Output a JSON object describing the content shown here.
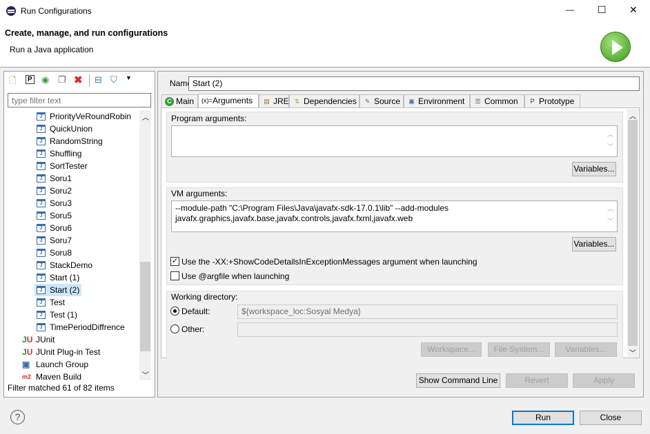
{
  "window": {
    "title": "Run Configurations",
    "minimize": "—",
    "maximize": "☐",
    "close": "✕"
  },
  "header": {
    "title": "Create, manage, and run configurations",
    "subtitle": "Run a Java application"
  },
  "left": {
    "filter_placeholder": "type filter text",
    "tree": [
      "PriorityVeRoundRobin",
      "QuickUnion",
      "RandomString",
      "Shuffling",
      "SortTester",
      "Soru1",
      "Soru2",
      "Soru3",
      "Soru5",
      "Soru6",
      "Soru7",
      "Soru8",
      "StackDemo",
      "Start (1)",
      "Start (2)",
      "Test",
      "Test (1)",
      "TimePeriodDiffrence"
    ],
    "selected": "Start (2)",
    "categories": [
      "JUnit",
      "JUnit Plug-in Test",
      "Launch Group",
      "Maven Build"
    ],
    "status": "Filter matched 61 of 82 items"
  },
  "right": {
    "name_label": "Name:",
    "name_value": "Start (2)",
    "tabs": [
      {
        "label": "Main",
        "icon": "C"
      },
      {
        "label": "Arguments",
        "icon": "(x)="
      },
      {
        "label": "JRE",
        "icon": "▤"
      },
      {
        "label": "Dependencies",
        "icon": "⇅"
      },
      {
        "label": "Source",
        "icon": "✎"
      },
      {
        "label": "Environment",
        "icon": "▣"
      },
      {
        "label": "Common",
        "icon": "☰"
      },
      {
        "label": "Prototype",
        "icon": "P"
      }
    ],
    "active_tab": "Arguments",
    "program_args": {
      "label": "Program arguments:",
      "value": "",
      "variables": "Variables..."
    },
    "vm_args": {
      "label": "VM arguments:",
      "line1": "--module-path \"C:\\Program Files\\Java\\javafx-sdk-17.0.1\\lib\" --add-modules",
      "line2": "javafx.graphics,javafx.base,javafx.controls,javafx.fxml,javafx.web",
      "variables": "Variables..."
    },
    "show_code_details": {
      "label": "Use the -XX:+ShowCodeDetailsInExceptionMessages argument when launching",
      "checked": true
    },
    "argfile": {
      "label": "Use @argfile when launching",
      "checked": false
    },
    "working_dir": {
      "label": "Working directory:",
      "default_label": "Default:",
      "default_value": "${workspace_loc:Sosyal Medya}",
      "other_label": "Other:",
      "other_value": "",
      "workspace": "Workspace...",
      "file_system": "File System...",
      "variables": "Variables..."
    },
    "show_command_line": "Show Command Line",
    "revert": "Revert",
    "apply": "Apply"
  },
  "footer": {
    "run": "Run",
    "close": "Close",
    "help": "?"
  }
}
